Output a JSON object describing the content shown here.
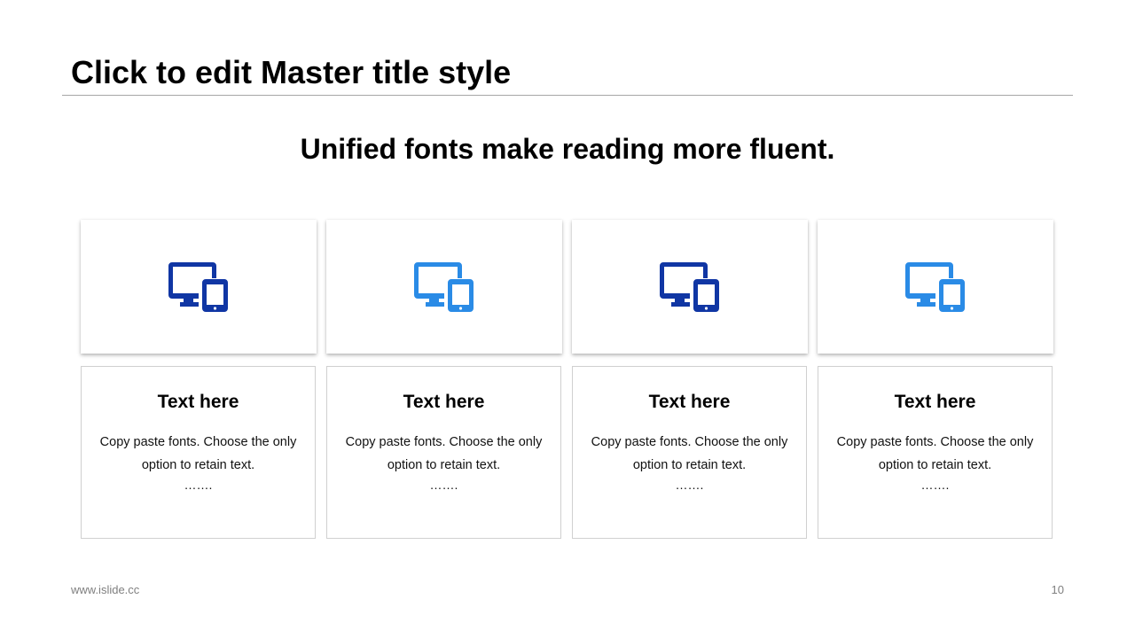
{
  "slide": {
    "title": "Click to edit Master title style",
    "subtitle": "Unified fonts make reading more fluent.",
    "footer_url": "www.islide.cc",
    "page_number": "10"
  },
  "colors": {
    "dark_blue": "#1036A4",
    "light_blue": "#2A8BE6"
  },
  "cards": [
    {
      "icon": "devices-icon",
      "icon_color": "#1036A4",
      "heading": "Text here",
      "body": "Copy paste fonts. Choose the only option to retain text.",
      "dots": "……."
    },
    {
      "icon": "devices-icon",
      "icon_color": "#2A8BE6",
      "heading": "Text here",
      "body": "Copy paste fonts. Choose the only option to retain text.",
      "dots": "……."
    },
    {
      "icon": "devices-icon",
      "icon_color": "#1036A4",
      "heading": "Text here",
      "body": "Copy paste fonts. Choose the only option to retain text.",
      "dots": "……."
    },
    {
      "icon": "devices-icon",
      "icon_color": "#2A8BE6",
      "heading": "Text here",
      "body": "Copy paste fonts. Choose the only option to retain text.",
      "dots": "……."
    }
  ]
}
